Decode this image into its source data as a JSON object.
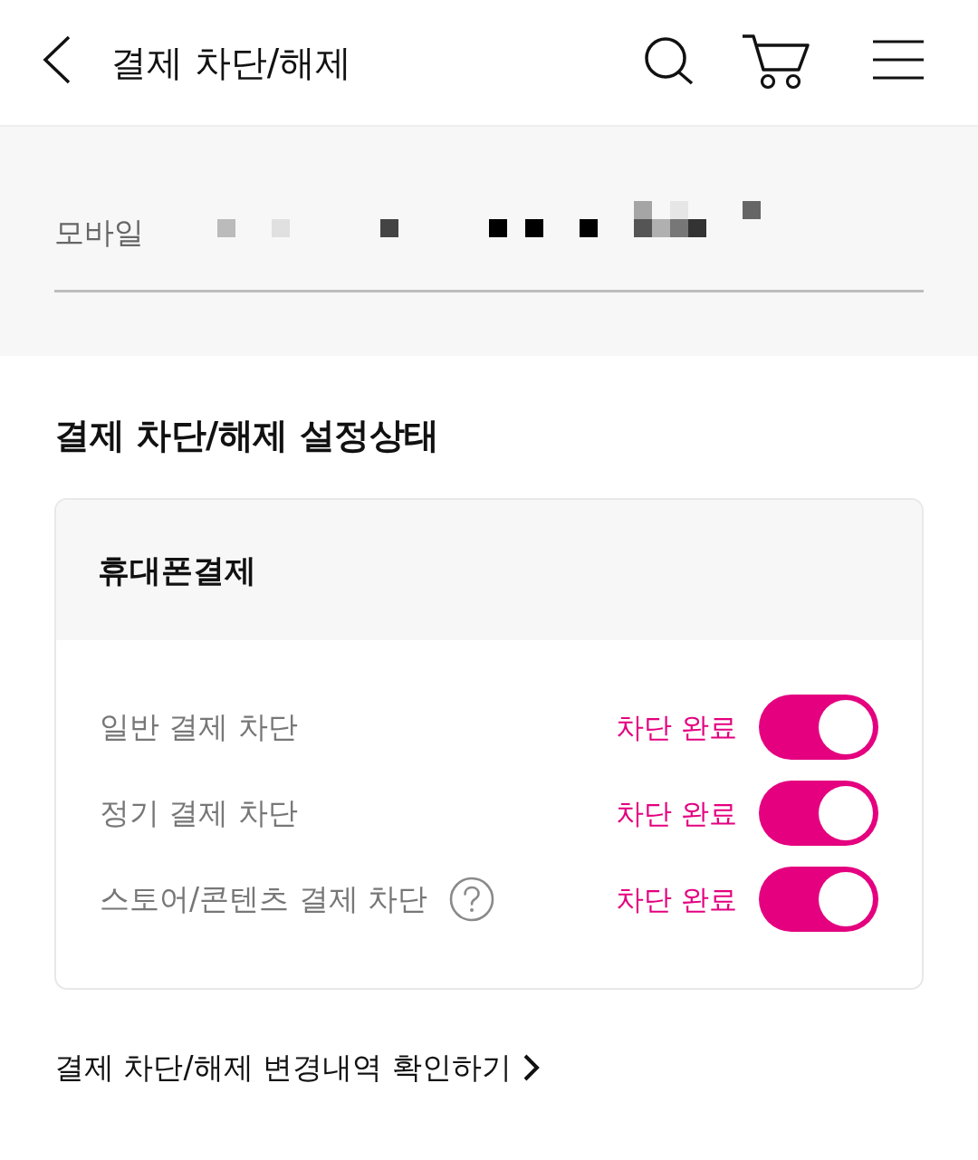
{
  "header": {
    "title": "결제 차단/해제"
  },
  "account": {
    "label": "모바일"
  },
  "status": {
    "title": "결제 차단/해제 설정상태",
    "card": {
      "title": "휴대폰결제",
      "rows": [
        {
          "label": "일반 결제 차단",
          "status": "차단 완료",
          "on": true,
          "help": false
        },
        {
          "label": "정기 결제 차단",
          "status": "차단 완료",
          "on": true,
          "help": false
        },
        {
          "label": "스토어/콘텐츠 결제 차단",
          "status": "차단 완료",
          "on": true,
          "help": true
        }
      ]
    }
  },
  "history_link": {
    "label": "결제 차단/해제 변경내역 확인하기"
  }
}
